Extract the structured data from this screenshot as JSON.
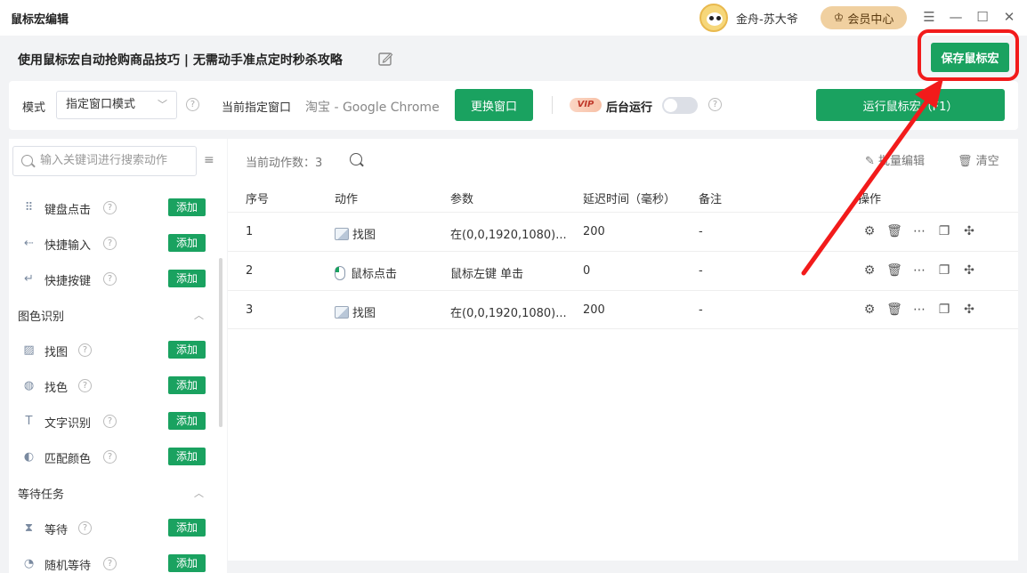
{
  "window": {
    "title": "鼠标宏编辑",
    "username": "金舟-苏大爷",
    "vip_center_label": "会员中心",
    "controls": [
      "menu-icon",
      "minimize-icon",
      "maximize-icon",
      "close-icon"
    ]
  },
  "macro": {
    "name": "使用鼠标宏自动抢购商品技巧 | 无需动手准点定时秒杀攻略",
    "save_label": "保存鼠标宏"
  },
  "toolbar": {
    "mode_label": "模式",
    "mode_value": "指定窗口模式",
    "window_label": "当前指定窗口",
    "window_value": "淘宝 - Google Chrome",
    "switch_label": "更换窗口",
    "vip_badge": "VIP",
    "background_label": "后台运行",
    "background_enabled": false,
    "run_label": "运行鼠标宏（F1）"
  },
  "sidebar": {
    "search_placeholder": "输入关键词进行搜索动作",
    "add_label": "添加",
    "items_top": [
      {
        "label": "键盘点击",
        "icon": "keyboard-icon"
      },
      {
        "label": "快捷输入",
        "icon": "input-icon"
      },
      {
        "label": "快捷按键",
        "icon": "enter-key-icon"
      }
    ],
    "group_image": {
      "title": "图色识别",
      "items": [
        {
          "label": "找图",
          "icon": "image-icon"
        },
        {
          "label": "找色",
          "icon": "palette-icon"
        },
        {
          "label": "文字识别",
          "icon": "text-icon"
        },
        {
          "label": "匹配颜色",
          "icon": "color-match-icon"
        }
      ]
    },
    "group_wait": {
      "title": "等待任务",
      "items": [
        {
          "label": "等待",
          "icon": "hourglass-icon"
        },
        {
          "label": "随机等待",
          "icon": "random-wait-icon"
        }
      ]
    }
  },
  "main": {
    "count_label": "当前动作数：3",
    "batch_edit_label": "批量编辑",
    "clear_label": "清空",
    "columns": [
      "序号",
      "动作",
      "参数",
      "延迟时间（毫秒）",
      "备注",
      "操作"
    ],
    "rows": [
      {
        "index": "1",
        "action": "找图",
        "param": "在(0,0,1920,1080)...",
        "delay": "200",
        "note": "-"
      },
      {
        "index": "2",
        "action": "鼠标点击",
        "param": "鼠标左键 单击",
        "delay": "0",
        "note": "-"
      },
      {
        "index": "3",
        "action": "找图",
        "param": "在(0,0,1920,1080)...",
        "delay": "200",
        "note": "-"
      }
    ]
  },
  "colors": {
    "accent": "#1aa260",
    "annotation": "#f21b1b"
  }
}
